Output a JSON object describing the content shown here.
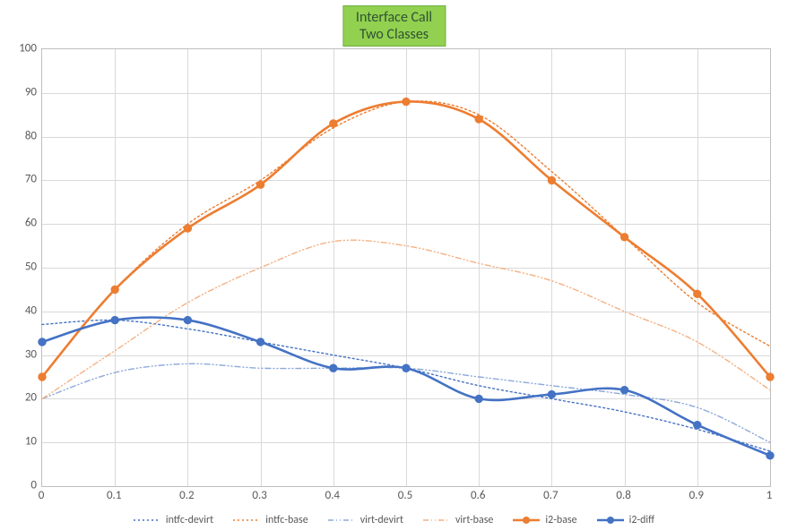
{
  "title_line1": "Interface Call",
  "title_line2": "Two Classes",
  "chart_data": {
    "type": "line",
    "xlabel": "",
    "ylabel": "",
    "xlim": [
      0,
      1
    ],
    "ylim": [
      0,
      100
    ],
    "x_ticks": [
      0,
      0.1,
      0.2,
      0.3,
      0.4,
      0.5,
      0.6,
      0.7,
      0.8,
      0.9,
      1
    ],
    "y_ticks": [
      0,
      10,
      20,
      30,
      40,
      50,
      60,
      70,
      80,
      90,
      100
    ],
    "categories": [
      0,
      0.1,
      0.2,
      0.3,
      0.4,
      0.5,
      0.6,
      0.7,
      0.8,
      0.9,
      1
    ],
    "series": [
      {
        "name": "intfc-devirt",
        "values": [
          37,
          38,
          36,
          33,
          30,
          27,
          23,
          20,
          17,
          13,
          8
        ],
        "color": "#4472c4",
        "dash": "2,3",
        "width": 1.4,
        "markers": false
      },
      {
        "name": "intfc-base",
        "values": [
          25,
          45,
          60,
          70,
          82,
          88,
          85,
          72,
          57,
          42,
          32
        ],
        "color": "#ed7d31",
        "dash": "2,3",
        "width": 1.4,
        "markers": false
      },
      {
        "name": "virt-devirt",
        "values": [
          20,
          26,
          28,
          27,
          27,
          27,
          25,
          23,
          21,
          18,
          10
        ],
        "color": "#8ea9db",
        "dash": "6,3,1,3,1,3",
        "width": 1.4,
        "markers": false
      },
      {
        "name": "virt-base",
        "values": [
          20,
          31,
          42,
          50,
          56,
          55,
          51,
          47,
          40,
          33,
          22
        ],
        "color": "#f4b183",
        "dash": "6,3,1,3,1,3",
        "width": 1.4,
        "markers": false
      },
      {
        "name": "i2-base",
        "values": [
          25,
          45,
          59,
          69,
          83,
          88,
          84,
          70,
          57,
          44,
          25
        ],
        "color": "#ed7d31",
        "dash": "",
        "width": 2.6,
        "markers": true
      },
      {
        "name": "i2-diff",
        "values": [
          33,
          38,
          38,
          33,
          27,
          27,
          20,
          21,
          22,
          14,
          7
        ],
        "color": "#4472c4",
        "dash": "",
        "width": 2.6,
        "markers": true
      }
    ]
  }
}
